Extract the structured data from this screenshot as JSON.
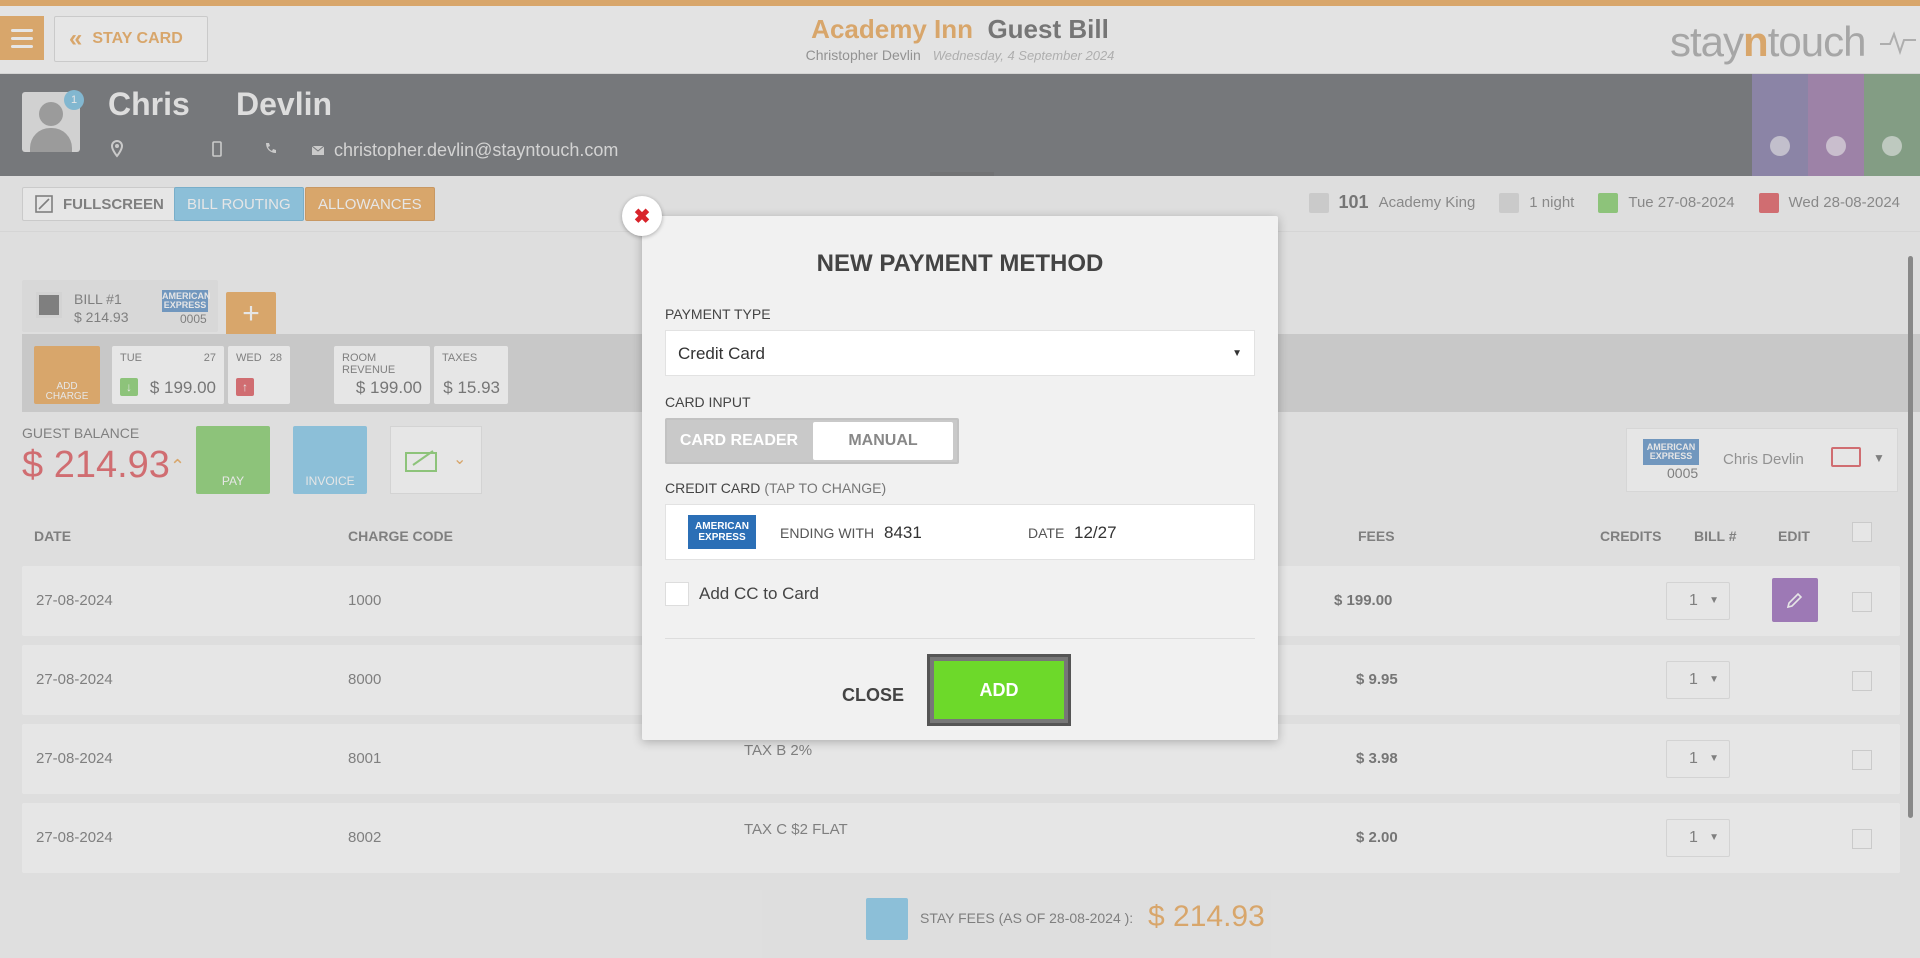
{
  "header": {
    "staycard_label": "STAY CARD",
    "hotel_name": "Academy Inn",
    "page_name": "Guest Bill",
    "guest_fullname": "Christopher Devlin",
    "date": "Wednesday, 4 September 2024",
    "brand_pre": "stay",
    "brand_n": "n",
    "brand_post": "touch"
  },
  "guest": {
    "first_name": "Chris",
    "last_name": "Devlin",
    "badge_count": "1",
    "email": "christopher.devlin@stayntouch.com",
    "side_tab_colors": [
      "#5a4e8a",
      "#7a4a8c",
      "#4b7a4e"
    ]
  },
  "toolbar": {
    "fullscreen_label": "FULLSCREEN",
    "bill_routing_label": "BILL ROUTING",
    "allowances_label": "ALLOWANCES",
    "room_number": "101",
    "room_type": "Academy King",
    "nights": "1 night",
    "arrival": "Tue 27-08-2024",
    "departure": "Wed 28-08-2024"
  },
  "bill": {
    "bill_label": "BILL #1",
    "bill_amount": "$ 214.93",
    "card_brand_line1": "AMERICAN",
    "card_brand_line2": "EXPRESS",
    "card_last4": "0005",
    "add_charge_label": "ADD CHARGE",
    "day1_name": "TUE",
    "day1_num": "27",
    "day1_amount": "$ 199.00",
    "day2_name": "WED",
    "day2_num": "28",
    "room_revenue_label": "ROOM REVENUE",
    "room_revenue_amount": "$ 199.00",
    "taxes_label": "TAXES",
    "taxes_amount": "$ 15.93"
  },
  "balance": {
    "label": "GUEST BALANCE",
    "amount": "$ 214.93",
    "pay_label": "PAY",
    "invoice_label": "INVOICE",
    "card_holder": "Chris Devlin"
  },
  "table": {
    "headers": {
      "date": "DATE",
      "charge_code": "CHARGE CODE",
      "fees": "FEES",
      "credits": "CREDITS",
      "bill_no": "BILL #",
      "edit": "EDIT"
    },
    "rows": [
      {
        "date": "27-08-2024",
        "code": "1000",
        "desc": "",
        "fee": "$ 199.00",
        "bill": "1"
      },
      {
        "date": "27-08-2024",
        "code": "8000",
        "desc": "",
        "fee": "$ 9.95",
        "bill": "1"
      },
      {
        "date": "27-08-2024",
        "code": "8001",
        "desc": "TAX B 2%",
        "fee": "$ 3.98",
        "bill": "1"
      },
      {
        "date": "27-08-2024",
        "code": "8002",
        "desc": "TAX C $2 FLAT",
        "fee": "$ 2.00",
        "bill": "1"
      }
    ]
  },
  "footer": {
    "stay_fees_label": "STAY FEES (AS OF  28-08-2024 ):",
    "stay_fees_amount": "$ 214.93"
  },
  "modal": {
    "title": "NEW PAYMENT METHOD",
    "payment_type_label": "PAYMENT TYPE",
    "payment_type_value": "Credit Card",
    "card_input_label": "CARD INPUT",
    "card_reader_label": "CARD READER",
    "manual_label": "MANUAL",
    "credit_card_label": "CREDIT CARD",
    "tap_to_change": "(TAP TO CHANGE)",
    "ending_with_label": "ENDING WITH",
    "ending_with_value": "8431",
    "date_label": "DATE",
    "date_value": "12/27",
    "add_cc_label": "Add CC to Card",
    "close_label": "CLOSE",
    "add_label": "ADD"
  },
  "colors": {
    "accent": "#e58a1f",
    "balance_red": "#d8232a",
    "add_green": "#6dd92a",
    "edit_purple": "#7b3aa6",
    "header_dark": "#34373c"
  }
}
